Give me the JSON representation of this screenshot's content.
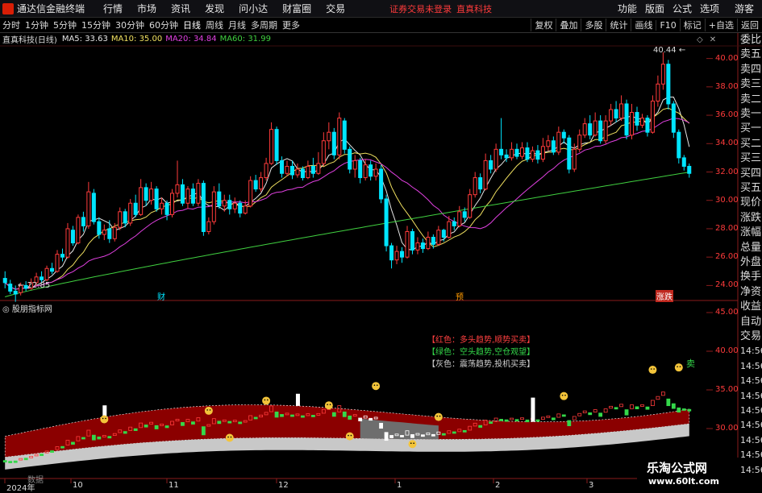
{
  "app": {
    "title": "通达信金融终端",
    "notice": "证券交易未登录",
    "notice_stock": "直真科技"
  },
  "menu": [
    "行情",
    "市场",
    "资讯",
    "发现",
    "问小达",
    "财富圈",
    "交易"
  ],
  "right_menu": [
    "功能",
    "版面",
    "公式",
    "选项"
  ],
  "guest_label": "游客",
  "toolbar": {
    "periods": [
      "分时",
      "1分钟",
      "5分钟",
      "15分钟",
      "30分钟",
      "60分钟",
      "日线",
      "周线",
      "月线",
      "多周期",
      "更多"
    ],
    "active_period": "日线",
    "right": [
      "复权",
      "叠加",
      "多股",
      "统计",
      "画线",
      "F10",
      "标记",
      "+自选",
      "返回"
    ]
  },
  "legend": {
    "title": "直真科技(日线)",
    "items": [
      {
        "label": "MA5: 33.63",
        "color": "#e6e6e6"
      },
      {
        "label": "MA10: 35.00",
        "color": "#f0e060"
      },
      {
        "label": "MA20: 34.84",
        "color": "#e040e0"
      },
      {
        "label": "MA60: 31.99",
        "color": "#40d040"
      }
    ]
  },
  "right_panel": [
    "委比",
    "卖五",
    "卖四",
    "卖三",
    "卖二",
    "卖一",
    "买一",
    "买二",
    "买三",
    "买四",
    "买五",
    "现价",
    "涨跌",
    "涨幅",
    "总量",
    "外盘",
    "换手",
    "净资",
    "收益",
    "自动",
    "交易",
    "14:56",
    "14:56",
    "14:56",
    "14:56",
    "14:56",
    "14:56",
    "14:56",
    "14:56",
    "14:56"
  ],
  "price_axis": [
    "40.00",
    "38.00",
    "36.00",
    "34.00",
    "32.00",
    "30.00",
    "28.00",
    "26.00",
    "24.00"
  ],
  "ind_axis": [
    "45.00",
    "40.00",
    "35.00",
    "30.00"
  ],
  "annotations": {
    "high": "40.44",
    "low": "22.85"
  },
  "markers": [
    "财",
    "预",
    "涨",
    "跌"
  ],
  "indicator": {
    "title": "股朋指标网",
    "legend": [
      "【红色：多头趋势,顺势买卖】",
      "【绿色：空头趋势,空仓观望】",
      "【灰色：震荡趋势,投机买卖】"
    ],
    "sell_label": "卖"
  },
  "x_ticks": [
    "2024年",
    "10",
    "11",
    "12",
    "1",
    "2",
    "3"
  ],
  "x_tick_prefix": "数据",
  "watermark": {
    "title": "乐淘公式网",
    "url": "www.60lt.com"
  },
  "colors": {
    "up": "#ff3b3b",
    "down": "#00e5ff",
    "ma5": "#e6e6e6",
    "ma10": "#f0e060",
    "ma20": "#e040e0",
    "ma60": "#40d040",
    "band": "#8b0000"
  },
  "chart_data": {
    "type": "candlestick",
    "ylim": [
      23,
      41
    ],
    "low_label": 22.85,
    "high_label": 40.44,
    "candles": [
      {
        "o": 24.5,
        "c": 24.2,
        "h": 25.0,
        "l": 23.8
      },
      {
        "o": 24.1,
        "c": 23.6,
        "h": 24.4,
        "l": 23.4
      },
      {
        "o": 23.6,
        "c": 23.4,
        "h": 24.0,
        "l": 22.85
      },
      {
        "o": 23.5,
        "c": 24.0,
        "h": 24.2,
        "l": 23.3
      },
      {
        "o": 24.0,
        "c": 23.8,
        "h": 24.3,
        "l": 23.6
      },
      {
        "o": 23.8,
        "c": 24.2,
        "h": 24.5,
        "l": 23.7
      },
      {
        "o": 24.2,
        "c": 24.6,
        "h": 24.9,
        "l": 24.0
      },
      {
        "o": 24.6,
        "c": 24.4,
        "h": 25.0,
        "l": 24.2
      },
      {
        "o": 24.4,
        "c": 25.2,
        "h": 25.4,
        "l": 24.3
      },
      {
        "o": 25.2,
        "c": 25.0,
        "h": 25.6,
        "l": 24.8
      },
      {
        "o": 25.0,
        "c": 26.2,
        "h": 26.5,
        "l": 24.9
      },
      {
        "o": 26.2,
        "c": 26.0,
        "h": 26.6,
        "l": 25.7
      },
      {
        "o": 26.0,
        "c": 28.0,
        "h": 28.4,
        "l": 25.9
      },
      {
        "o": 27.9,
        "c": 27.0,
        "h": 28.2,
        "l": 26.8
      },
      {
        "o": 27.0,
        "c": 28.8,
        "h": 29.0,
        "l": 26.9
      },
      {
        "o": 28.8,
        "c": 28.2,
        "h": 29.2,
        "l": 27.8
      },
      {
        "o": 28.2,
        "c": 30.6,
        "h": 31.3,
        "l": 28.0
      },
      {
        "o": 30.5,
        "c": 28.5,
        "h": 30.8,
        "l": 28.3
      },
      {
        "o": 28.5,
        "c": 27.6,
        "h": 28.8,
        "l": 27.3
      },
      {
        "o": 27.6,
        "c": 27.9,
        "h": 28.3,
        "l": 27.2
      },
      {
        "o": 28.0,
        "c": 27.3,
        "h": 28.6,
        "l": 27.0
      },
      {
        "o": 27.3,
        "c": 28.1,
        "h": 28.4,
        "l": 27.1
      },
      {
        "o": 28.1,
        "c": 29.2,
        "h": 29.5,
        "l": 27.9
      },
      {
        "o": 29.2,
        "c": 28.4,
        "h": 29.4,
        "l": 28.1
      },
      {
        "o": 28.4,
        "c": 29.8,
        "h": 30.1,
        "l": 28.2
      },
      {
        "o": 29.8,
        "c": 29.0,
        "h": 30.4,
        "l": 28.8
      },
      {
        "o": 29.0,
        "c": 30.9,
        "h": 31.5,
        "l": 28.9
      },
      {
        "o": 30.9,
        "c": 30.0,
        "h": 31.2,
        "l": 29.6
      },
      {
        "o": 30.0,
        "c": 30.8,
        "h": 31.3,
        "l": 29.7
      },
      {
        "o": 30.8,
        "c": 29.4,
        "h": 31.0,
        "l": 29.2
      },
      {
        "o": 29.4,
        "c": 29.8,
        "h": 30.2,
        "l": 29.0
      },
      {
        "o": 29.8,
        "c": 29.0,
        "h": 30.0,
        "l": 28.6
      },
      {
        "o": 29.0,
        "c": 30.5,
        "h": 30.8,
        "l": 28.8
      },
      {
        "o": 30.5,
        "c": 31.1,
        "h": 32.8,
        "l": 30.2
      },
      {
        "o": 31.1,
        "c": 29.8,
        "h": 31.5,
        "l": 29.6
      },
      {
        "o": 29.8,
        "c": 30.8,
        "h": 31.0,
        "l": 29.4
      },
      {
        "o": 30.8,
        "c": 29.8,
        "h": 31.2,
        "l": 29.6
      },
      {
        "o": 29.8,
        "c": 31.2,
        "h": 31.5,
        "l": 29.6
      },
      {
        "o": 31.2,
        "c": 27.8,
        "h": 31.4,
        "l": 27.5
      },
      {
        "o": 27.8,
        "c": 28.5,
        "h": 28.8,
        "l": 27.6
      },
      {
        "o": 28.5,
        "c": 30.6,
        "h": 31.0,
        "l": 28.3
      },
      {
        "o": 30.6,
        "c": 29.6,
        "h": 31.2,
        "l": 29.4
      },
      {
        "o": 29.6,
        "c": 30.0,
        "h": 30.4,
        "l": 29.2
      },
      {
        "o": 30.0,
        "c": 29.4,
        "h": 30.4,
        "l": 29.0
      },
      {
        "o": 29.4,
        "c": 29.8,
        "h": 30.2,
        "l": 29.1
      },
      {
        "o": 29.8,
        "c": 29.1,
        "h": 30.0,
        "l": 28.8
      },
      {
        "o": 29.1,
        "c": 29.6,
        "h": 30.0,
        "l": 29.0
      },
      {
        "o": 29.6,
        "c": 31.4,
        "h": 31.7,
        "l": 29.5
      },
      {
        "o": 31.4,
        "c": 30.8,
        "h": 31.8,
        "l": 30.6
      },
      {
        "o": 30.8,
        "c": 31.6,
        "h": 32.0,
        "l": 30.6
      },
      {
        "o": 31.6,
        "c": 32.6,
        "h": 33.0,
        "l": 31.4
      },
      {
        "o": 32.6,
        "c": 35.0,
        "h": 35.5,
        "l": 32.5
      },
      {
        "o": 35.0,
        "c": 32.8,
        "h": 35.2,
        "l": 32.5
      },
      {
        "o": 32.8,
        "c": 31.9,
        "h": 33.1,
        "l": 31.6
      },
      {
        "o": 31.9,
        "c": 32.4,
        "h": 32.8,
        "l": 31.7
      },
      {
        "o": 32.4,
        "c": 31.8,
        "h": 32.8,
        "l": 31.5
      },
      {
        "o": 31.8,
        "c": 32.2,
        "h": 32.6,
        "l": 31.6
      },
      {
        "o": 32.2,
        "c": 31.6,
        "h": 32.4,
        "l": 31.4
      },
      {
        "o": 31.6,
        "c": 32.4,
        "h": 32.8,
        "l": 31.5
      },
      {
        "o": 32.4,
        "c": 31.9,
        "h": 33.0,
        "l": 31.6
      },
      {
        "o": 31.9,
        "c": 32.6,
        "h": 33.4,
        "l": 31.8
      },
      {
        "o": 32.6,
        "c": 34.2,
        "h": 34.8,
        "l": 32.4
      },
      {
        "o": 34.2,
        "c": 34.8,
        "h": 35.5,
        "l": 33.6
      },
      {
        "o": 34.8,
        "c": 33.2,
        "h": 35.1,
        "l": 32.9
      },
      {
        "o": 33.2,
        "c": 35.8,
        "h": 36.2,
        "l": 32.9
      },
      {
        "o": 35.6,
        "c": 33.6,
        "h": 35.8,
        "l": 33.3
      },
      {
        "o": 33.6,
        "c": 32.2,
        "h": 33.8,
        "l": 31.9
      },
      {
        "o": 32.2,
        "c": 32.8,
        "h": 33.2,
        "l": 31.6
      },
      {
        "o": 32.8,
        "c": 31.6,
        "h": 33.0,
        "l": 31.2
      },
      {
        "o": 31.6,
        "c": 32.5,
        "h": 32.9,
        "l": 31.4
      },
      {
        "o": 32.5,
        "c": 31.7,
        "h": 32.8,
        "l": 31.4
      },
      {
        "o": 31.7,
        "c": 32.2,
        "h": 32.6,
        "l": 31.4
      },
      {
        "o": 32.2,
        "c": 30.1,
        "h": 32.5,
        "l": 29.8
      },
      {
        "o": 30.1,
        "c": 26.8,
        "h": 30.4,
        "l": 26.4
      },
      {
        "o": 26.8,
        "c": 25.8,
        "h": 27.0,
        "l": 25.2
      },
      {
        "o": 25.8,
        "c": 26.4,
        "h": 26.8,
        "l": 25.5
      },
      {
        "o": 26.4,
        "c": 26.0,
        "h": 26.7,
        "l": 25.6
      },
      {
        "o": 26.0,
        "c": 27.8,
        "h": 28.2,
        "l": 25.9
      },
      {
        "o": 27.8,
        "c": 26.5,
        "h": 28.0,
        "l": 26.2
      },
      {
        "o": 26.5,
        "c": 27.0,
        "h": 27.4,
        "l": 26.2
      },
      {
        "o": 27.0,
        "c": 26.6,
        "h": 27.3,
        "l": 26.3
      },
      {
        "o": 26.6,
        "c": 27.4,
        "h": 27.8,
        "l": 26.5
      },
      {
        "o": 27.4,
        "c": 26.9,
        "h": 27.6,
        "l": 26.6
      },
      {
        "o": 26.9,
        "c": 27.9,
        "h": 28.2,
        "l": 26.8
      },
      {
        "o": 27.9,
        "c": 27.4,
        "h": 28.0,
        "l": 27.1
      },
      {
        "o": 27.4,
        "c": 28.5,
        "h": 28.9,
        "l": 27.3
      },
      {
        "o": 28.5,
        "c": 28.2,
        "h": 28.8,
        "l": 27.9
      },
      {
        "o": 28.2,
        "c": 29.2,
        "h": 29.6,
        "l": 28.1
      },
      {
        "o": 29.2,
        "c": 28.8,
        "h": 29.5,
        "l": 28.5
      },
      {
        "o": 28.8,
        "c": 30.4,
        "h": 30.8,
        "l": 28.7
      },
      {
        "o": 30.4,
        "c": 31.6,
        "h": 32.0,
        "l": 30.2
      },
      {
        "o": 31.6,
        "c": 30.8,
        "h": 31.9,
        "l": 30.5
      },
      {
        "o": 30.8,
        "c": 32.8,
        "h": 33.3,
        "l": 30.7
      },
      {
        "o": 32.8,
        "c": 32.2,
        "h": 33.2,
        "l": 31.9
      },
      {
        "o": 32.2,
        "c": 33.6,
        "h": 34.0,
        "l": 32.0
      },
      {
        "o": 33.6,
        "c": 33.2,
        "h": 35.8,
        "l": 32.9
      },
      {
        "o": 33.2,
        "c": 33.0,
        "h": 33.6,
        "l": 32.7
      },
      {
        "o": 33.0,
        "c": 33.6,
        "h": 34.1,
        "l": 32.8
      },
      {
        "o": 33.6,
        "c": 33.1,
        "h": 34.0,
        "l": 32.9
      },
      {
        "o": 33.1,
        "c": 33.7,
        "h": 34.1,
        "l": 32.9
      },
      {
        "o": 33.7,
        "c": 32.9,
        "h": 34.1,
        "l": 32.7
      },
      {
        "o": 32.9,
        "c": 33.5,
        "h": 33.8,
        "l": 32.7
      },
      {
        "o": 33.5,
        "c": 32.9,
        "h": 33.9,
        "l": 32.6
      },
      {
        "o": 32.9,
        "c": 33.8,
        "h": 34.4,
        "l": 32.7
      },
      {
        "o": 33.8,
        "c": 34.2,
        "h": 34.6,
        "l": 33.5
      },
      {
        "o": 34.2,
        "c": 33.4,
        "h": 34.5,
        "l": 33.2
      },
      {
        "o": 33.4,
        "c": 34.8,
        "h": 35.2,
        "l": 33.2
      },
      {
        "o": 34.8,
        "c": 34.4,
        "h": 35.0,
        "l": 34.0
      },
      {
        "o": 34.4,
        "c": 32.2,
        "h": 34.6,
        "l": 31.9
      },
      {
        "o": 32.2,
        "c": 33.6,
        "h": 34.0,
        "l": 32.0
      },
      {
        "o": 33.6,
        "c": 34.6,
        "h": 35.0,
        "l": 33.4
      },
      {
        "o": 34.6,
        "c": 35.4,
        "h": 35.8,
        "l": 34.4
      },
      {
        "o": 35.4,
        "c": 34.6,
        "h": 36.0,
        "l": 34.3
      },
      {
        "o": 34.6,
        "c": 35.6,
        "h": 36.2,
        "l": 34.5
      },
      {
        "o": 35.6,
        "c": 34.2,
        "h": 36.0,
        "l": 34.0
      },
      {
        "o": 34.2,
        "c": 35.6,
        "h": 36.0,
        "l": 34.0
      },
      {
        "o": 35.6,
        "c": 36.4,
        "h": 36.8,
        "l": 35.3
      },
      {
        "o": 36.4,
        "c": 35.8,
        "h": 37.0,
        "l": 35.5
      },
      {
        "o": 35.8,
        "c": 36.8,
        "h": 37.4,
        "l": 35.6
      },
      {
        "o": 36.8,
        "c": 34.6,
        "h": 37.1,
        "l": 34.3
      },
      {
        "o": 34.6,
        "c": 36.2,
        "h": 36.8,
        "l": 34.3
      },
      {
        "o": 36.2,
        "c": 35.3,
        "h": 36.6,
        "l": 34.9
      },
      {
        "o": 35.3,
        "c": 35.8,
        "h": 36.1,
        "l": 35.1
      },
      {
        "o": 35.8,
        "c": 34.8,
        "h": 36.0,
        "l": 34.5
      },
      {
        "o": 34.8,
        "c": 37.0,
        "h": 37.4,
        "l": 34.7
      },
      {
        "o": 37.0,
        "c": 38.2,
        "h": 38.8,
        "l": 36.6
      },
      {
        "o": 38.2,
        "c": 39.6,
        "h": 40.44,
        "l": 37.8
      },
      {
        "o": 39.6,
        "c": 36.8,
        "h": 39.9,
        "l": 36.4
      },
      {
        "o": 36.8,
        "c": 34.8,
        "h": 37.0,
        "l": 34.4
      },
      {
        "o": 34.8,
        "c": 33.0,
        "h": 35.0,
        "l": 32.6
      },
      {
        "o": 33.0,
        "c": 32.4,
        "h": 33.2,
        "l": 32.1
      },
      {
        "o": 32.4,
        "c": 31.9,
        "h": 32.6,
        "l": 31.6
      }
    ]
  }
}
